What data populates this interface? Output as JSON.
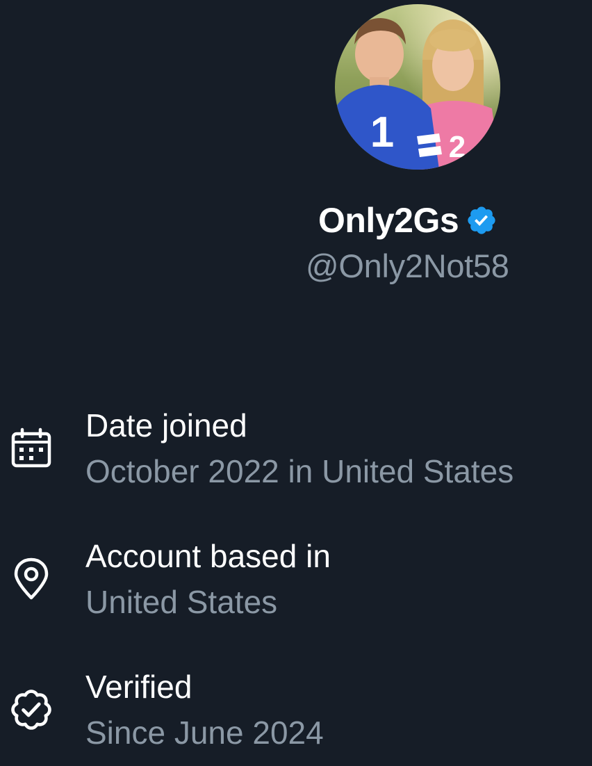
{
  "profile": {
    "display_name": "Only2Gs",
    "handle": "@Only2Not58",
    "verified_badge_color": "#1d9bf0",
    "avatar_icon": "profile-photo-two-children",
    "avatar_jersey_numbers": [
      "1",
      "2"
    ]
  },
  "about": {
    "items": [
      {
        "icon": "calendar-icon",
        "label": "Date joined",
        "value": "October 2022 in United States"
      },
      {
        "icon": "location-pin-icon",
        "label": "Account based in",
        "value": "United States"
      },
      {
        "icon": "verified-badge-outline-icon",
        "label": "Verified",
        "value": "Since June 2024"
      }
    ]
  },
  "colors": {
    "background": "#161d27",
    "primary_text": "#ffffff",
    "secondary_text": "#8b98a5"
  }
}
